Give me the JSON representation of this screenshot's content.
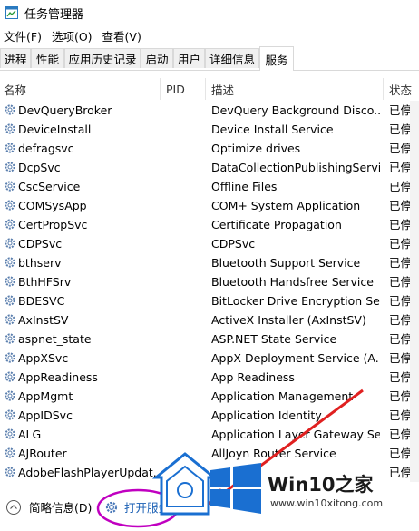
{
  "window": {
    "title": "任务管理器"
  },
  "menu": [
    "文件(F)",
    "选项(O)",
    "查看(V)"
  ],
  "tabs": [
    "进程",
    "性能",
    "应用历史记录",
    "启动",
    "用户",
    "详细信息",
    "服务"
  ],
  "active_tab": "服务",
  "columns": {
    "name": "名称",
    "pid": "PID",
    "desc": "描述",
    "status": "状态"
  },
  "rows": [
    {
      "name": "DevQueryBroker",
      "desc": "DevQuery Background Disco...",
      "status": "已停止"
    },
    {
      "name": "DeviceInstall",
      "desc": "Device Install Service",
      "status": "已停止"
    },
    {
      "name": "defragsvc",
      "desc": "Optimize drives",
      "status": "已停止"
    },
    {
      "name": "DcpSvc",
      "desc": "DataCollectionPublishingServi...",
      "status": "已停止"
    },
    {
      "name": "CscService",
      "desc": "Offline Files",
      "status": "已停止"
    },
    {
      "name": "COMSysApp",
      "desc": "COM+ System Application",
      "status": "已停止"
    },
    {
      "name": "CertPropSvc",
      "desc": "Certificate Propagation",
      "status": "已停止"
    },
    {
      "name": "CDPSvc",
      "desc": "CDPSvc",
      "status": "已停止"
    },
    {
      "name": "bthserv",
      "desc": "Bluetooth Support Service",
      "status": "已停止"
    },
    {
      "name": "BthHFSrv",
      "desc": "Bluetooth Handsfree Service",
      "status": "已停止"
    },
    {
      "name": "BDESVC",
      "desc": "BitLocker Drive Encryption Se...",
      "status": "已停止"
    },
    {
      "name": "AxInstSV",
      "desc": "ActiveX Installer (AxInstSV)",
      "status": "已停止"
    },
    {
      "name": "aspnet_state",
      "desc": "ASP.NET State Service",
      "status": "已停止"
    },
    {
      "name": "AppXSvc",
      "desc": "AppX Deployment Service (A...",
      "status": "已停止"
    },
    {
      "name": "AppReadiness",
      "desc": "App Readiness",
      "status": "已停止"
    },
    {
      "name": "AppMgmt",
      "desc": "Application Management",
      "status": "已停止"
    },
    {
      "name": "AppIDSvc",
      "desc": "Application Identity",
      "status": "已停止"
    },
    {
      "name": "ALG",
      "desc": "Application Layer Gateway Se...",
      "status": "已停止"
    },
    {
      "name": "AJRouter",
      "desc": "AllJoyn Router Service",
      "status": "已停止"
    },
    {
      "name": "AdobeFlashPlayerUpdat...",
      "desc": "",
      "status": "已停止"
    }
  ],
  "footer": {
    "summary": "简略信息(D)",
    "open_services": "打开服务"
  },
  "watermark": {
    "brand": "Win10之家",
    "url": "www.win10xitong.com"
  },
  "colors": {
    "annotation_circle": "#c000c0",
    "annotation_arrow": "#e02020",
    "gear": "#4a78b8",
    "logo_blue": "#1a6fd1"
  }
}
